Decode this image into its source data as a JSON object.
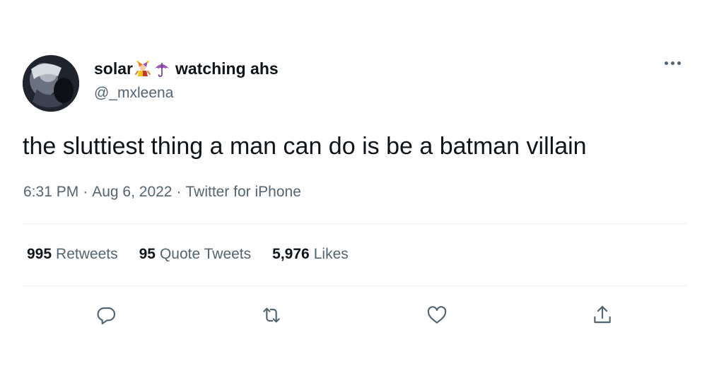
{
  "tweet": {
    "author": {
      "name_prefix": "solar",
      "name_suffix": "watching ahs",
      "name_emojis": [
        "jester-emoji",
        "umbrella-emoji"
      ],
      "handle": "@_mxleena"
    },
    "text": "the sluttiest thing a man can do is be a batman villain",
    "meta": {
      "time": "6:31 PM",
      "separator": "·",
      "date": "Aug 6, 2022",
      "source": "Twitter for iPhone"
    },
    "stats": [
      {
        "value": "995",
        "label": "Retweets"
      },
      {
        "value": "95",
        "label": "Quote Tweets"
      },
      {
        "value": "5,976",
        "label": "Likes"
      }
    ],
    "actions": [
      "reply-icon",
      "retweet-icon",
      "like-icon",
      "share-icon"
    ],
    "colors": {
      "text": "#0f1419",
      "secondary": "#536471",
      "divider": "#eff3f4",
      "umbrella": "#9b59b6"
    }
  }
}
